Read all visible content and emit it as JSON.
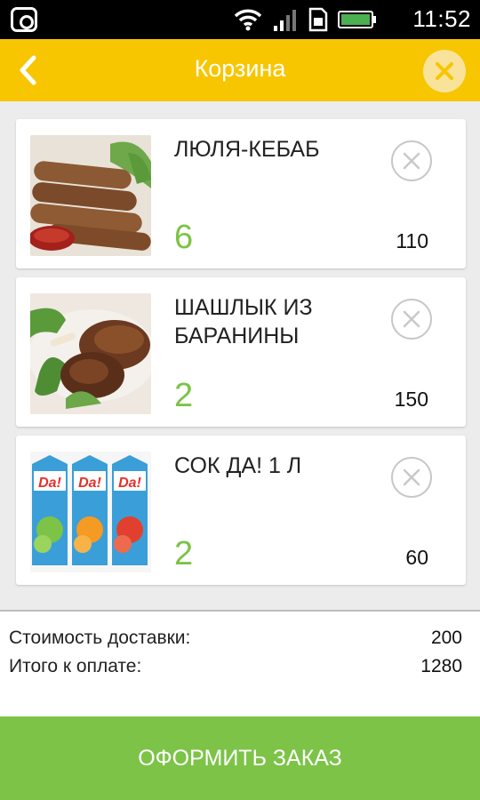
{
  "status_bar": {
    "time": "11:52",
    "icons": [
      "instagram-icon",
      "wifi-icon",
      "signal-icon",
      "sim-icon",
      "battery-icon"
    ]
  },
  "header": {
    "title": "Корзина",
    "back_icon": "chevron-left-icon",
    "close_icon": "close-icon",
    "color": "#f7c600"
  },
  "cart_items": [
    {
      "name": "ЛЮЛЯ-КЕБАБ",
      "quantity": "6",
      "price": "110",
      "image": "lula-kebab-photo"
    },
    {
      "name": "ШАШЛЫК ИЗ БАРАНИНЫ",
      "quantity": "2",
      "price": "150",
      "image": "lamb-shashlik-photo"
    },
    {
      "name": "СОК ДА! 1 Л",
      "quantity": "2",
      "price": "60",
      "image": "juice-cartons-photo"
    }
  ],
  "summary": {
    "delivery_label": "Стоимость доставки:",
    "delivery_value": "200",
    "total_label": "Итого к оплате:",
    "total_value": "1280"
  },
  "order_button": {
    "label": "ОФОРМИТЬ ЗАКАЗ",
    "color": "#7cc347"
  },
  "accent_colors": {
    "quantity": "#7cc347",
    "header": "#f7c600"
  }
}
